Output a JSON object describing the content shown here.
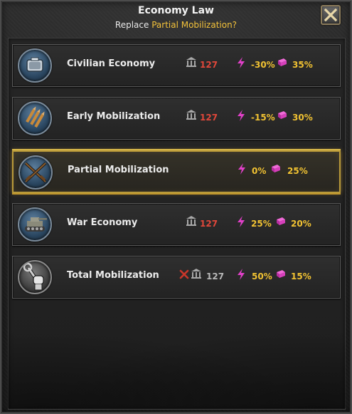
{
  "window": {
    "title": "Economy Law",
    "subtitle_prefix": "Replace ",
    "subtitle_highlight": "Partial Mobilization?"
  },
  "colors": {
    "accent_yellow": "#f1c232",
    "cost_red": "#e0473a",
    "consumer_goods_magenta": "#e040c8",
    "selected_border": "#b99a3a"
  },
  "laws": [
    {
      "name": "Civilian Economy",
      "icon": "piggy-bank-icon",
      "cost": "127",
      "factory_mod": "-30%",
      "consumer_goods": "35%",
      "selected": false
    },
    {
      "name": "Early Mobilization",
      "icon": "bullets-icon",
      "cost": "127",
      "factory_mod": "-15%",
      "consumer_goods": "30%",
      "selected": false
    },
    {
      "name": "Partial Mobilization",
      "icon": "crossed-rifles-icon",
      "cost": "",
      "factory_mod": "0%",
      "consumer_goods": "25%",
      "selected": true
    },
    {
      "name": "War Economy",
      "icon": "tank-icon",
      "cost": "127",
      "factory_mod": "25%",
      "consumer_goods": "20%",
      "selected": false
    },
    {
      "name": "Total Mobilization",
      "icon": "fist-wrench-icon",
      "cost": "127",
      "factory_mod": "50%",
      "consumer_goods": "15%",
      "selected": false,
      "unavailable": true
    }
  ]
}
